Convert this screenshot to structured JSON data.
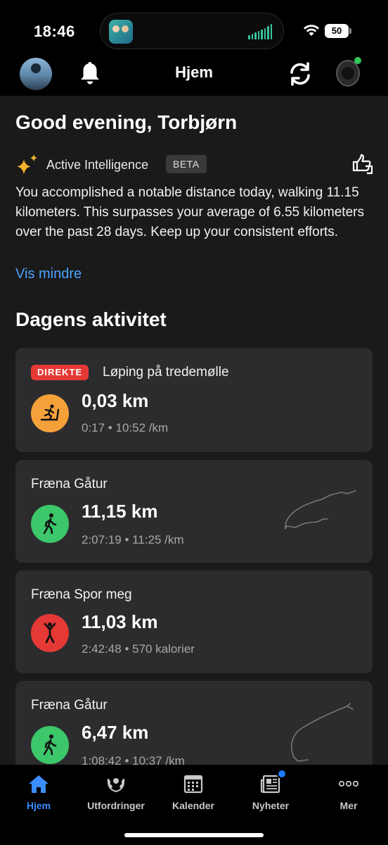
{
  "status_bar": {
    "time": "18:46",
    "battery": "50"
  },
  "header": {
    "title": "Hjem"
  },
  "greeting": "Good evening, Torbjørn",
  "ai": {
    "label": "Active Intelligence",
    "badge": "BETA",
    "text": "You accomplished a notable distance today, walking 11.15 kilometers. This surpasses your average of 6.55 kilometers over the past 28 days. Keep up your consistent efforts.",
    "less_link": "Vis mindre"
  },
  "section_title": "Dagens aktivitet",
  "activities": [
    {
      "live_badge": "DIREKTE",
      "title": "Løping på tredemølle",
      "distance": "0,03 km",
      "meta": "0:17 • 10:52 /km",
      "icon": "treadmill-run-icon",
      "color": "#f5a13a"
    },
    {
      "title": "Fræna Gåtur",
      "distance": "11,15 km",
      "meta": "2:07:19 • 11:25 /km",
      "icon": "walking-icon",
      "color": "#3cc76a"
    },
    {
      "title": "Fræna Spor meg",
      "distance": "11,03 km",
      "meta": "2:42:48 • 570 kalorier",
      "icon": "person-arms-up-icon",
      "color": "#e53935"
    },
    {
      "title": "Fræna Gåtur",
      "distance": "6,47 km",
      "meta": "1:08:42 • 10:37 /km",
      "icon": "walking-icon",
      "color": "#3cc76a"
    }
  ],
  "tabs": [
    {
      "label": "Hjem",
      "icon": "home-icon"
    },
    {
      "label": "Utfordringer",
      "icon": "laurel-icon"
    },
    {
      "label": "Kalender",
      "icon": "calendar-icon"
    },
    {
      "label": "Nyheter",
      "icon": "newspaper-icon"
    },
    {
      "label": "Mer",
      "icon": "more-dots-icon"
    }
  ],
  "colors": {
    "accent": "#3b8cff",
    "link": "#4da3ff",
    "card": "#2c2c2e",
    "live": "#e53935"
  }
}
